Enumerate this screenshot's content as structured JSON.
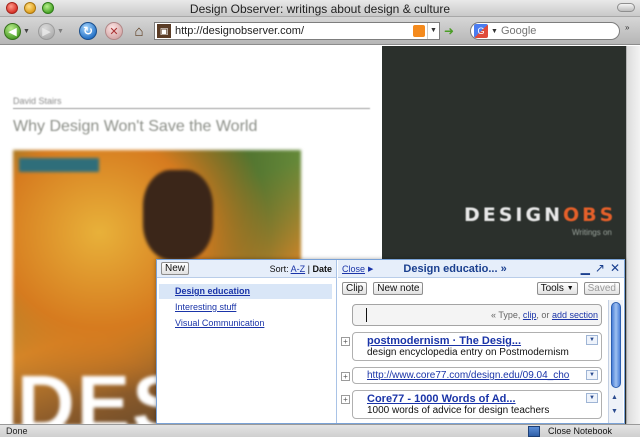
{
  "window": {
    "title": "Design Observer: writings about design & culture"
  },
  "toolbar": {
    "url": "http://designobserver.com/",
    "search_placeholder": "Google"
  },
  "page": {
    "author": "David Stairs",
    "article_title": "Why Design Won't Save the World",
    "hero_text": "DES",
    "brand_left": "DESIGN",
    "brand_right": "OBS",
    "brand_sub": "Writings on"
  },
  "status": {
    "text": "Done",
    "close_notebook": "Close Notebook"
  },
  "notebook": {
    "new_label": "New",
    "sort_label": "Sort:",
    "sort_az": "A-Z",
    "sort_sep": "|",
    "sort_date": "Date",
    "items": [
      {
        "label": "Design education",
        "selected": true
      },
      {
        "label": "Interesting stuff",
        "selected": false
      },
      {
        "label": "Visual Communication",
        "selected": false
      }
    ],
    "close_label": "Close",
    "title": "Design educatio... »",
    "clip_label": "Clip",
    "new_note_label": "New note",
    "tools_label": "Tools",
    "saved_label": "Saved",
    "input_hint_prefix": "« Type,",
    "input_hint_clip": "clip",
    "input_hint_or": ", or",
    "input_hint_add": "add section",
    "notes": [
      {
        "title": "postmodernism · The Desig...",
        "desc": "design encyclopedia entry on Postmodernism"
      },
      {
        "link": "http://www.core77.com/design.edu/09.04_cho"
      },
      {
        "title": "Core77 - 1000 Words of Ad...",
        "desc": "1000 words of advice for design teachers"
      }
    ]
  }
}
